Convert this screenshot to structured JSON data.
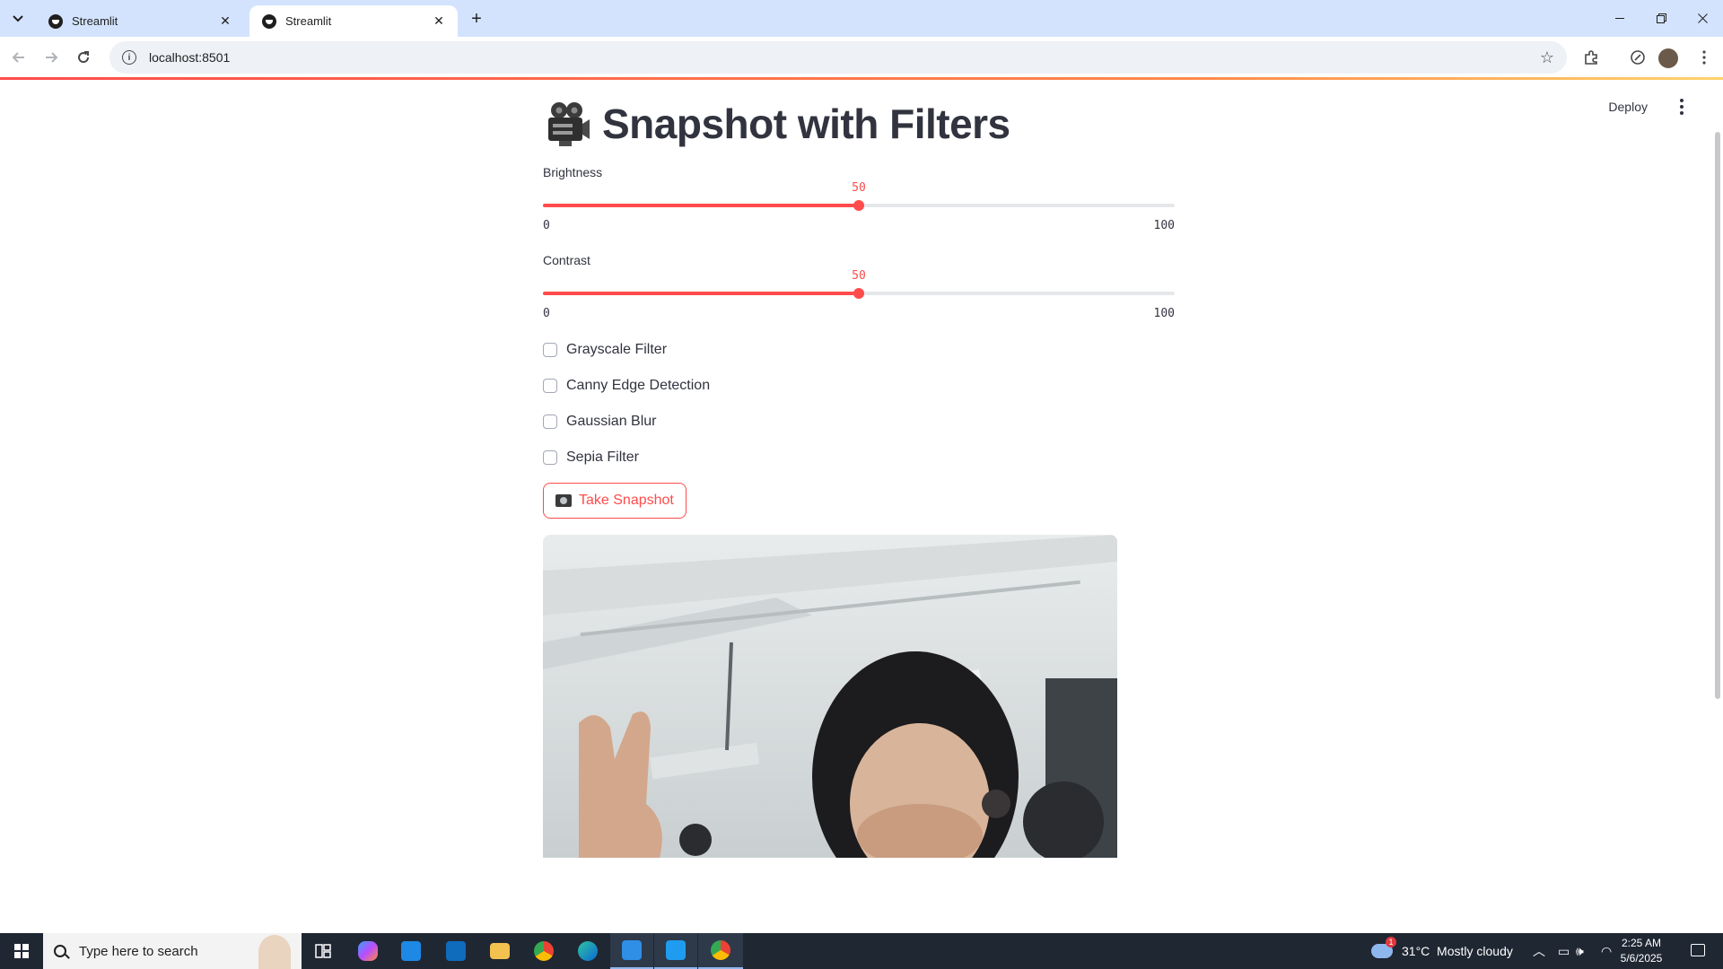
{
  "browser": {
    "tabs": [
      {
        "title": "Streamlit",
        "close": "✕"
      },
      {
        "title": "Streamlit",
        "close": "✕"
      }
    ],
    "new_tab": "+",
    "url": "localhost:8501",
    "window_controls": {
      "minimize": "—",
      "restore": "❐",
      "close": "✕"
    }
  },
  "app": {
    "deploy_label": "Deploy",
    "title": "Snapshot with Filters",
    "title_icon": "film-camera-icon",
    "sliders": [
      {
        "label": "Brightness",
        "value": 50,
        "min": 0,
        "max": 100
      },
      {
        "label": "Contrast",
        "value": 50,
        "min": 0,
        "max": 100
      }
    ],
    "checkboxes": [
      {
        "label": "Grayscale Filter",
        "checked": false
      },
      {
        "label": "Canny Edge Detection",
        "checked": false
      },
      {
        "label": "Gaussian Blur",
        "checked": false
      },
      {
        "label": "Sepia Filter",
        "checked": false
      }
    ],
    "snapshot_button": "Take Snapshot",
    "accent_color": "#ff4b4b",
    "text_color": "#31333f"
  },
  "taskbar": {
    "search_placeholder": "Type here to search",
    "weather": "31°C  Mostly cloudy",
    "weather_badge": "1",
    "time": "2:25 AM",
    "date": "5/6/2025"
  }
}
